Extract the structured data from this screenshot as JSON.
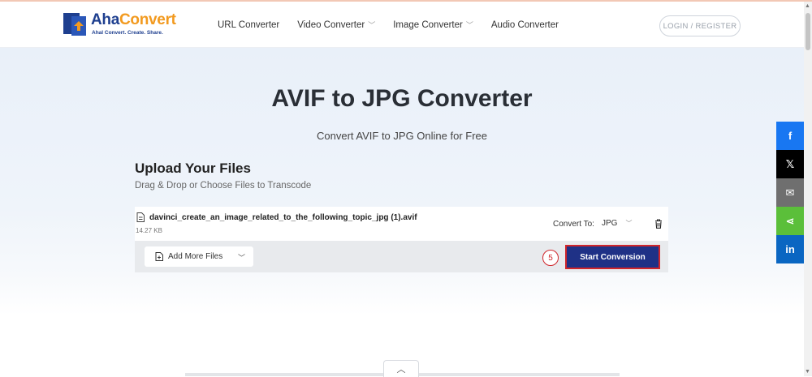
{
  "brand": {
    "name_a": "Aha",
    "name_b": "Convert",
    "tagline": "Ahal Convert. Create. Share."
  },
  "nav": {
    "items": [
      {
        "label": "URL Converter",
        "dropdown": false
      },
      {
        "label": "Video Converter",
        "dropdown": true
      },
      {
        "label": "Image Converter",
        "dropdown": true
      },
      {
        "label": "Audio Converter",
        "dropdown": false
      }
    ],
    "login_label": "LOGIN / REGISTER"
  },
  "hero": {
    "title": "AVIF to JPG Converter",
    "subtitle": "Convert AVIF to JPG Online for Free"
  },
  "upload": {
    "title": "Upload Your Files",
    "subtitle": "Drag & Drop or Choose Files to Transcode",
    "file": {
      "name": "davinci_create_an_image_related_to_the_following_topic_jpg (1).avif",
      "size": "14.27 KB",
      "convert_to_label": "Convert To:",
      "format": "JPG"
    },
    "add_more_label": "Add More Files",
    "step_marker": "5",
    "start_label": "Start Conversion"
  },
  "share": [
    {
      "icon": "facebook-icon",
      "glyph": "f",
      "color": "#1877f2"
    },
    {
      "icon": "x-icon",
      "glyph": "𝕏",
      "color": "#000000"
    },
    {
      "icon": "email-icon",
      "glyph": "✉",
      "color": "#6f6f6f"
    },
    {
      "icon": "share-icon",
      "glyph": "⋖",
      "color": "#5bbf3a"
    },
    {
      "icon": "linkedin-icon",
      "glyph": "in",
      "color": "#0a66c2"
    }
  ],
  "colors": {
    "primary": "#1f3186",
    "highlight": "#d0262b",
    "brand_blue": "#1e3f8f",
    "brand_orange": "#f29a1f"
  }
}
